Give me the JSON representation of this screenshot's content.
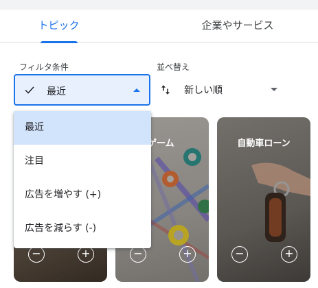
{
  "tabs": [
    {
      "label": "トピック",
      "active": true
    },
    {
      "label": "企業やサービス",
      "active": false
    }
  ],
  "filter": {
    "label": "フィルタ条件",
    "selected": "最近"
  },
  "sort": {
    "label": "並べ替え",
    "selected": "新しい順"
  },
  "menu": {
    "items": [
      {
        "label": "最近",
        "selected": true
      },
      {
        "label": "注目",
        "selected": false
      },
      {
        "label": "広告を増やす (+)",
        "selected": false
      },
      {
        "label": "広告を減らす (-)",
        "selected": false
      }
    ]
  },
  "cards": [
    {
      "title": "",
      "minus": "−",
      "plus": "+"
    },
    {
      "title": "ゲーム",
      "minus": "−",
      "plus": "+"
    },
    {
      "title": "自動車ローン",
      "minus": "−",
      "plus": "+"
    }
  ],
  "colors": {
    "accent": "#1a73e8",
    "selected_bg": "#d2e3fc",
    "select_bg": "#e8f0fe"
  },
  "icons": {
    "check": "check-icon",
    "sort": "swap-vert-icon",
    "caret_up": "caret-up-icon",
    "caret_down": "caret-down-icon"
  }
}
